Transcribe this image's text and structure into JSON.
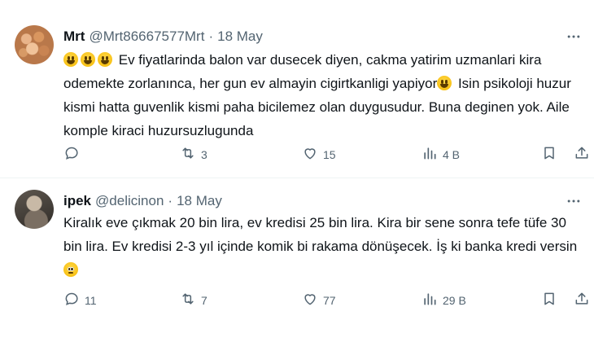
{
  "tweets": [
    {
      "name": "Mrt",
      "handle": "@Mrt86667577Mrt",
      "date": "18 May",
      "body_prefix_emojis": [
        "😀",
        "😀",
        "😀"
      ],
      "text_part1": "Ev fiyatlarinda balon var dusecek diyen, cakma yatirim uzmanlari kira odemekte zorlanınca, her gun ev almayin cigirtkanligi yapiyor",
      "inline_emoji": "😀",
      "text_part2": " Isin psikoloji huzur kismi hatta guvenlik kismi paha bicilemez olan duygusudur. Buna deginen yok. Aile komple kiraci huzursuzlugunda",
      "replies": "",
      "retweets": "3",
      "likes": "15",
      "views": "4 B"
    },
    {
      "name": "ipek",
      "handle": "@delicinon",
      "date": "18 May",
      "text_part1": "Kiralık eve çıkmak 20 bin lira, ev kredisi 25 bin lira. Kira bir sene sonra tefe tüfe 30 bin lira. Ev kredisi 2-3 yıl içinde komik bi rakama dönüşecek. İş ki banka kredi versin ",
      "inline_emoji": "🥺",
      "replies": "11",
      "retweets": "7",
      "likes": "77",
      "views": "29 B"
    }
  ],
  "icons": {
    "reply": "reply-icon",
    "retweet": "retweet-icon",
    "like": "heart-icon",
    "views": "views-icon",
    "bookmark": "bookmark-icon",
    "share": "share-icon",
    "more": "more-icon"
  },
  "colors": {
    "text": "#0f1419",
    "secondary": "#536471",
    "divider": "#eff3f4"
  }
}
